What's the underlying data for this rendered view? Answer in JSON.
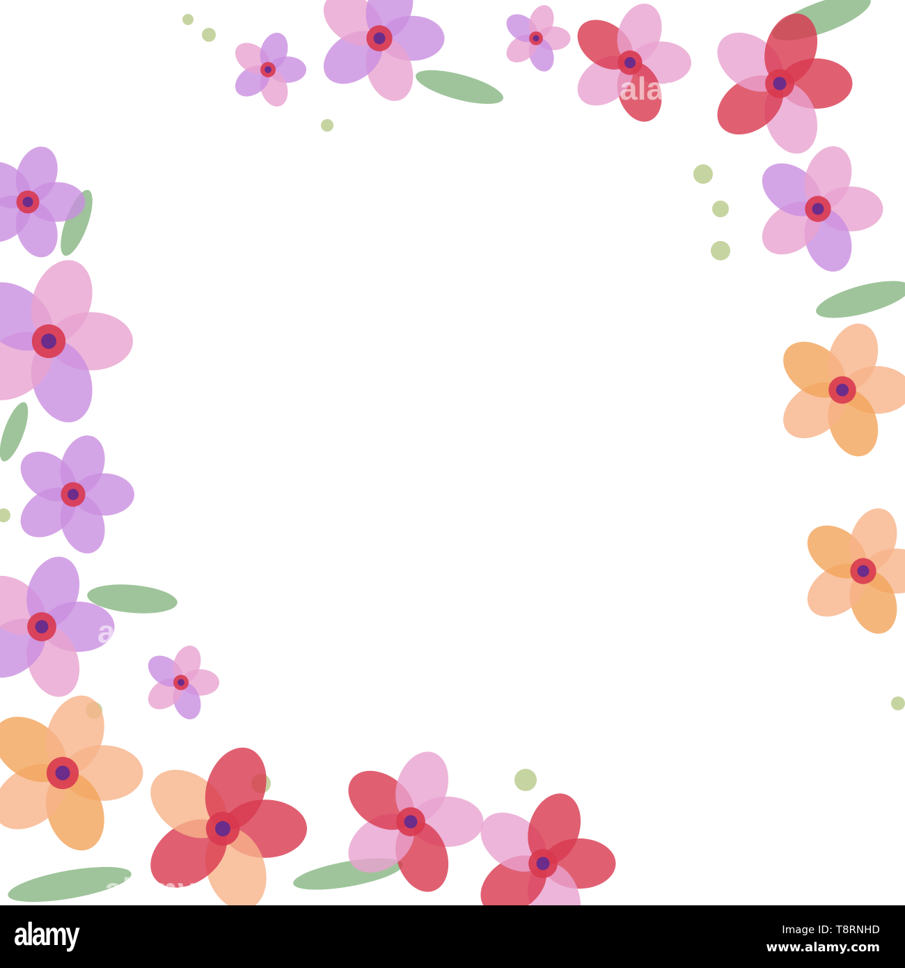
{
  "watermark": "alamy",
  "footer": {
    "logo": "alamy",
    "image_id": "Image ID: T8RNHD",
    "website": "www.alamy.com"
  },
  "palette": {
    "pink": "#e9a3cf",
    "lilac": "#c98fe0",
    "red": "#d8384f",
    "orange": "#f2a45a",
    "peach": "#f7b38a",
    "leaf": "#7fb07a",
    "center": "#6b2c8a"
  }
}
